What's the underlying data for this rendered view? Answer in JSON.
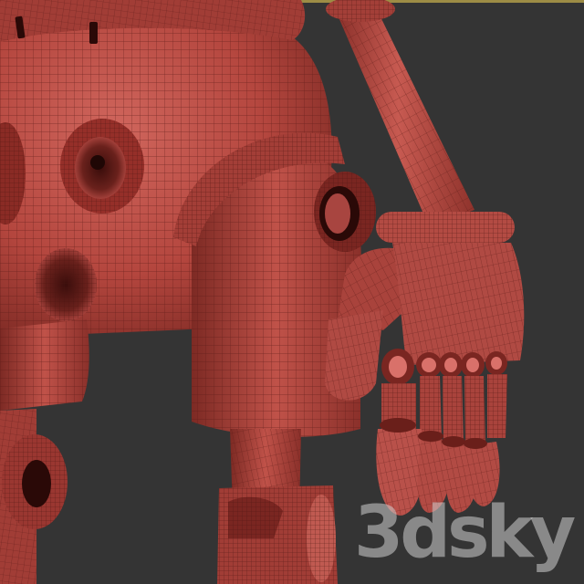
{
  "image": {
    "subject": "wireframe-robot-torso-arm-hand",
    "background_color": "#343434",
    "mesh_color": "#b5473f",
    "wire_color": "#5a1a16",
    "highlight_color": "#d9716a",
    "accent_rim_color": "#b8a24a"
  },
  "watermark": {
    "text": "3dsky",
    "color": "#d0d0d0"
  }
}
